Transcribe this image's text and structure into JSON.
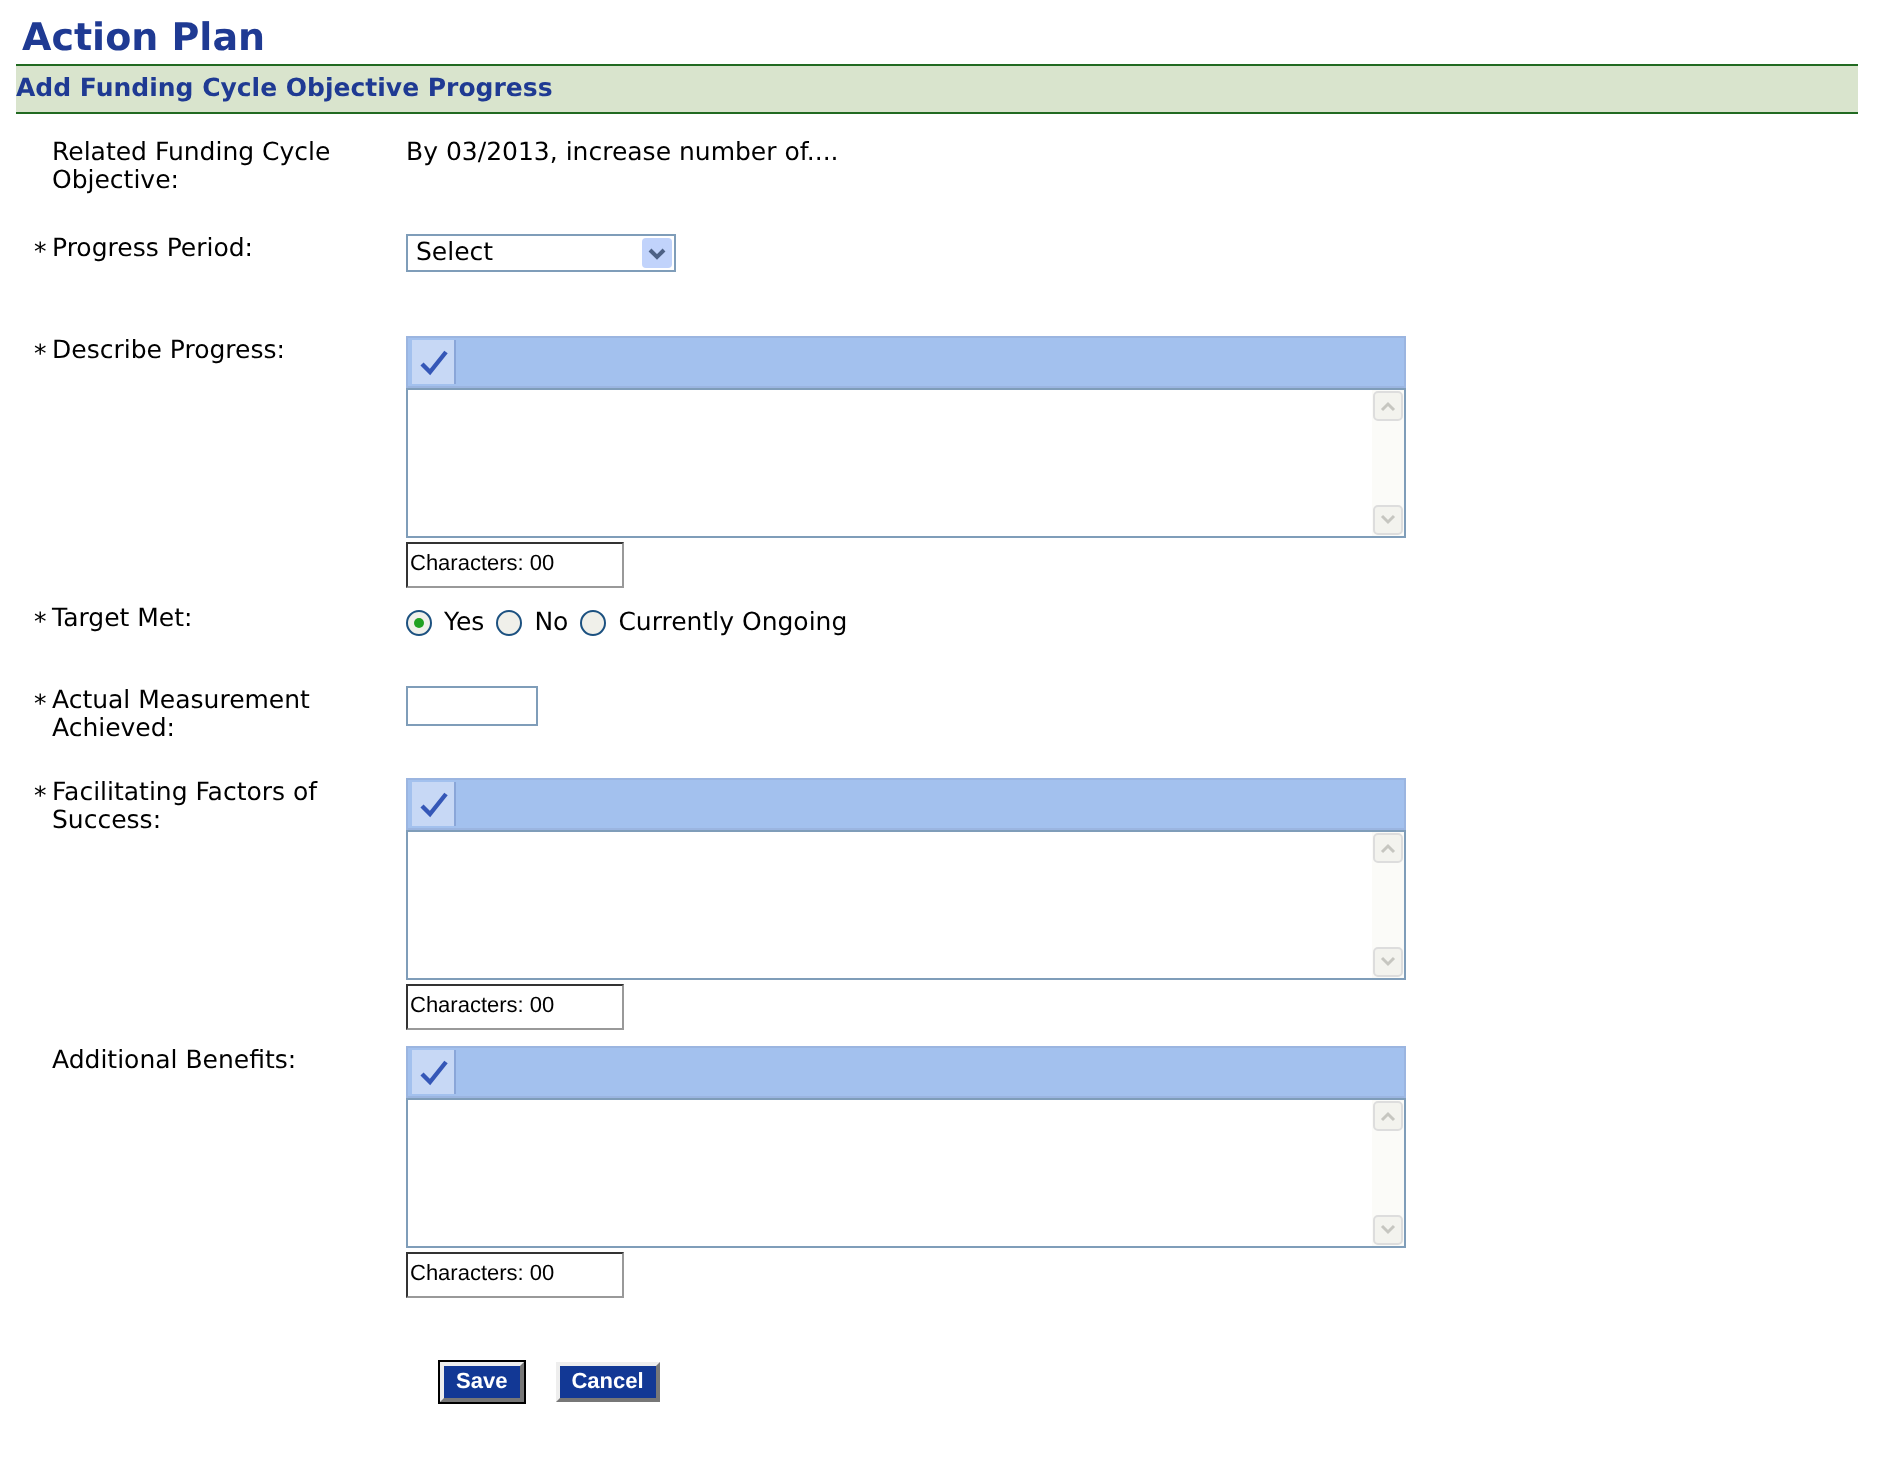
{
  "page_title": "Action Plan",
  "section_title": "Add Funding Cycle Objective Progress",
  "fields": [
    {
      "kind": "text",
      "label": "Related Funding Cycle Objective:",
      "value": "By 03/2013, increase number of...."
    },
    {
      "kind": "select",
      "marker": "*",
      "label": "Progress Period:",
      "value": "Select"
    },
    {
      "kind": "richtext",
      "marker": "*",
      "label": "Describe Progress:",
      "counter": "Characters: 00"
    },
    {
      "kind": "radio",
      "marker": "*",
      "label": "Target Met:",
      "options": [
        {
          "label": "Yes",
          "selected": true
        },
        {
          "label": "No",
          "selected": false
        },
        {
          "label": "Currently Ongoing",
          "selected": false
        }
      ]
    },
    {
      "kind": "input",
      "marker": "*",
      "label": "Actual Measurement Achieved:"
    },
    {
      "kind": "richtext",
      "marker": "*",
      "label": "Facilitating Factors of Success:",
      "counter": "Characters: 00"
    },
    {
      "kind": "richtext",
      "label": "Additional Benefits:",
      "counter": "Characters: 00"
    }
  ],
  "buttons": [
    {
      "label": "Save",
      "focused": true
    },
    {
      "label": "Cancel",
      "focused": false
    }
  ]
}
